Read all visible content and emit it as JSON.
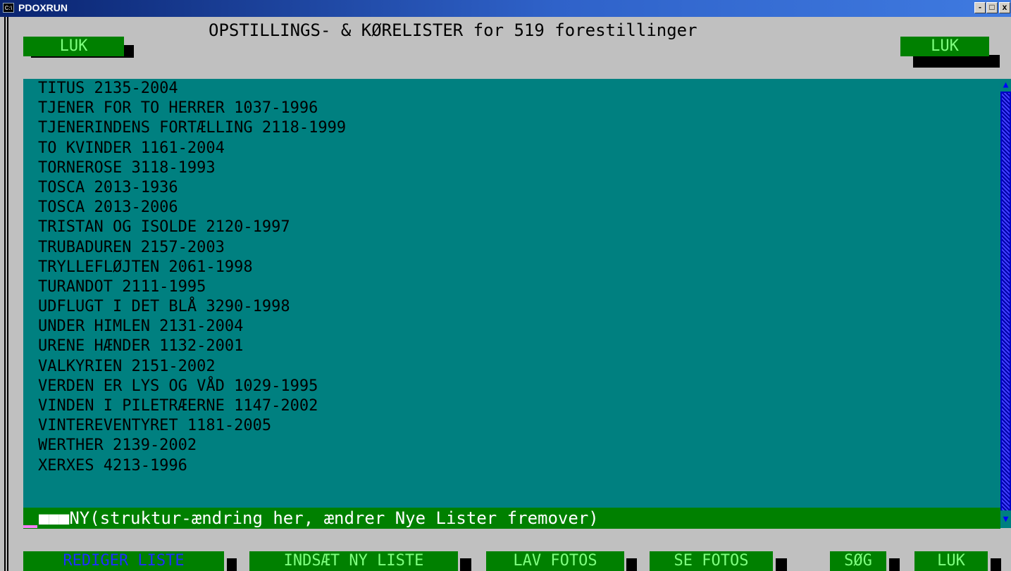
{
  "window": {
    "title": "PDOXRUN",
    "icon": "C:\\",
    "minimize": "-",
    "maximize": "□",
    "close": "x"
  },
  "header": {
    "title": "OPSTILLINGS- & KØRELISTER for 519 forestillinger",
    "close_left": "LUK",
    "close_right": "LUK"
  },
  "list": {
    "items": [
      "TITUS 2135-2004",
      "TJENER FOR TO HERRER 1037-1996",
      "TJENERINDENS FORTÆLLING 2118-1999",
      "TO KVINDER 1161-2004",
      "TORNEROSE 3118-1993",
      "TOSCA 2013-1936",
      "TOSCA 2013-2006",
      "TRISTAN OG ISOLDE 2120-1997",
      "TRUBADUREN 2157-2003",
      "TRYLLEFLØJTEN 2061-1998",
      "TURANDOT 2111-1995",
      "UDFLUGT I DET BLÅ 3290-1998",
      "UNDER HIMLEN 2131-2004",
      "URENE HÆNDER 1132-2001",
      "VALKYRIEN 2151-2002",
      "VERDEN ER LYS OG VÅD 1029-1995",
      "VINDEN I PILETRÆERNE 1147-2002",
      "VINTEREVENTYRET 1181-2005",
      "WERTHER 2139-2002",
      "XERXES 4213-1996"
    ],
    "new_row_marker": "■■■",
    "new_row": "NY(struktur-ændring her, ændrer Nye Lister fremover)"
  },
  "toolbar": {
    "edit": "REDIGER LISTE",
    "insert": "INDSÆT NY LISTE",
    "make_photos": "LAV FOTOS",
    "view_photos": "SE FOTOS",
    "search": "SØG",
    "close": "LUK"
  },
  "colors": {
    "list_bg": "#008080",
    "button_bg": "#008000",
    "button_text": "#7fff7f",
    "new_row_bg": "#008000",
    "frame_bg": "#c0c0c0"
  },
  "icons": {
    "scroll_up": "up-arrow-icon",
    "scroll_down": "down-arrow-icon",
    "cursor_marker": "block-cursor-icon"
  }
}
